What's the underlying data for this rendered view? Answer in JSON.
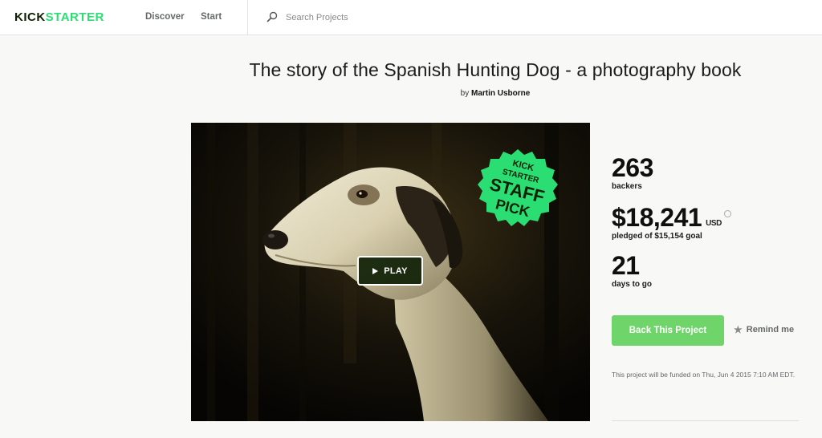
{
  "brand": {
    "part1": "KICK",
    "part2": "STARTER",
    "colors": {
      "green": "#2bde73",
      "dark": "#0f2105"
    }
  },
  "nav": {
    "items": [
      {
        "label": "Discover"
      },
      {
        "label": "Start"
      }
    ],
    "search": {
      "placeholder": "Search Projects",
      "icon": "search-icon"
    }
  },
  "project": {
    "title": "The story of the Spanish Hunting Dog - a photography book",
    "by_prefix": "by",
    "creator": "Martin Usborne"
  },
  "video": {
    "play_label": "PLAY",
    "badge": {
      "line1": "KICK",
      "line2": "STARTER",
      "line3": "STAFF",
      "line4": "PICK"
    }
  },
  "stats": {
    "backers": {
      "value": "263",
      "label": "backers"
    },
    "pledged": {
      "value": "$18,241",
      "currency": "USD",
      "label": "pledged of $15,154 goal"
    },
    "days": {
      "value": "21",
      "label": "days to go"
    }
  },
  "actions": {
    "back_label": "Back This Project",
    "remind_label": "Remind me",
    "back_color": "#6fd56b"
  },
  "funding_note": "This project will be funded on Thu, Jun 4 2015 7:10 AM EDT."
}
